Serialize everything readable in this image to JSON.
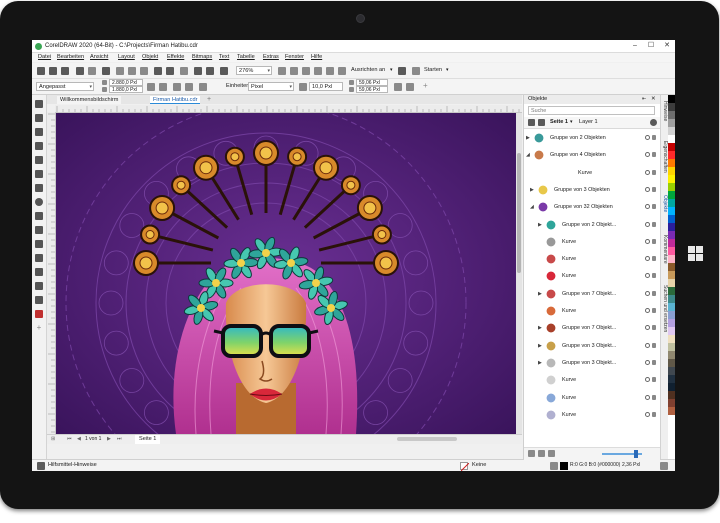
{
  "window": {
    "title": "CorelDRAW 2020 (64-Bit) - C:\\Projects\\Firman Hatibu.cdr"
  },
  "menu": [
    "Datei",
    "Bearbeiten",
    "Ansicht",
    "Layout",
    "Objekt",
    "Effekte",
    "Bitmaps",
    "Text",
    "Tabelle",
    "Extras",
    "Fenster",
    "Hilfe"
  ],
  "toolbar": {
    "zoom": "276%",
    "snap": "Ausrichten an",
    "launch": "Starten",
    "fit": "Angepasst",
    "width": "2.880,0 Pxl",
    "height": "1.880,0 Pxl",
    "units_label": "Einheiten:",
    "units": "Pixel",
    "nudge": "10,0 Pxl",
    "dup_x": "59,06 Pxl",
    "dup_y": "59,06 Pxl"
  },
  "tabs": [
    "Willkommensbildschirm",
    "Firman Hatibu.cdr"
  ],
  "page": {
    "label": "Seite 1"
  },
  "status": {
    "hint": "Hilfsmittel-Hinweise",
    "fill": "Keine",
    "outline": "R:0 G:0 B:0 (#000000)",
    "outline_width": "2,36 Pxl"
  },
  "objects_panel": {
    "title": "Objekte",
    "search_placeholder": "Suche",
    "page_tab": "Seite 1",
    "layer_tab": "Layer 1",
    "items": [
      {
        "label": "Gruppe von 2 Objekten",
        "thumb": "glasses"
      },
      {
        "label": "Gruppe von 4 Objekten",
        "thumb": "face"
      },
      {
        "label": "Kurve",
        "thumb": "none"
      },
      {
        "label": "Gruppe von 3 Objekten",
        "thumb": "halo"
      },
      {
        "label": "Gruppe von 32 Objekten",
        "thumb": "figure"
      },
      {
        "label": "Gruppe von 2 Objekt...",
        "thumb": "leaves"
      },
      {
        "label": "Kurve",
        "thumb": "line"
      },
      {
        "label": "Kurve",
        "thumb": "lips-outline"
      },
      {
        "label": "Kurve",
        "thumb": "lips"
      },
      {
        "label": "Gruppe von 7 Objekt...",
        "thumb": "dots"
      },
      {
        "label": "Kurve",
        "thumb": "bow"
      },
      {
        "label": "Gruppe von 7 Objekt...",
        "thumb": "rosette"
      },
      {
        "label": "Gruppe von 3 Objekt...",
        "thumb": "chain"
      },
      {
        "label": "Gruppe von 3 Objekt...",
        "thumb": "swirl"
      },
      {
        "label": "Kurve",
        "thumb": "stroke"
      },
      {
        "label": "Kurve",
        "thumb": "spots"
      },
      {
        "label": "Kurve",
        "thumb": "wave"
      }
    ]
  },
  "side_tabs": [
    "Hinweise",
    "Eigenschaften",
    "Objekte",
    "Kommentare",
    "Suchen und ersetzen"
  ],
  "palette": [
    "#000000",
    "#3c3c3c",
    "#6e6e6e",
    "#a0a0a0",
    "#d2d2d2",
    "#ffffff",
    "#c40000",
    "#ff2a2a",
    "#ff7a00",
    "#ffd400",
    "#fff200",
    "#9ad000",
    "#00a63c",
    "#00a8a0",
    "#00b4ff",
    "#0060d0",
    "#2a1e9c",
    "#7a2ab4",
    "#c02a9a",
    "#ff5aa0",
    "#ffb4c8",
    "#8a5a2a",
    "#c89a5a",
    "#e6d2a8",
    "#2a6a3a",
    "#3c8a8a",
    "#5ab4d2",
    "#8aa0d2",
    "#b4a0e0",
    "#e0c8f0",
    "#f0e0c0",
    "#c0c0a0",
    "#908870",
    "#605848",
    "#404850",
    "#203040",
    "#102030",
    "#503020",
    "#804030",
    "#b06040"
  ]
}
